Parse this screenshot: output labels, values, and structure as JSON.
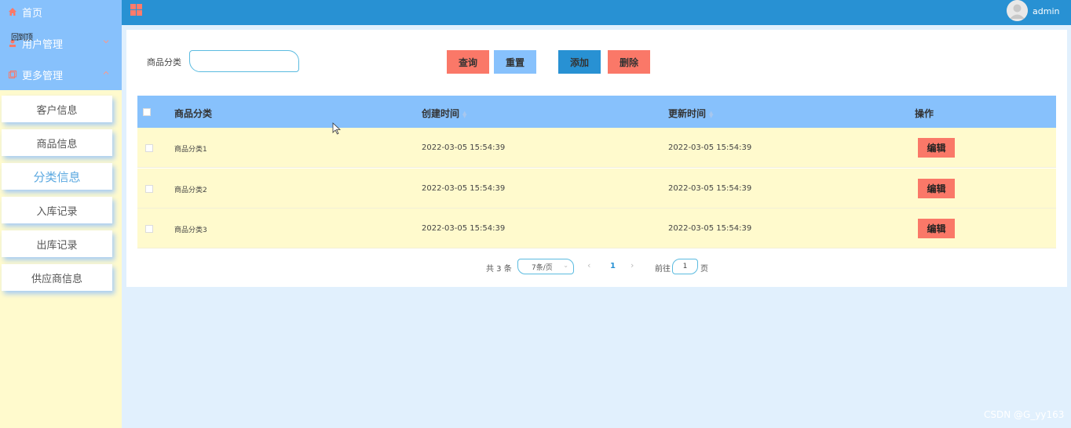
{
  "sidebar": {
    "home_label": "首页",
    "user_mgmt_label": "用户管理",
    "more_mgmt_label": "更多管理",
    "overlay_text": "回到顶",
    "items": [
      {
        "label": "客户信息"
      },
      {
        "label": "商品信息"
      },
      {
        "label": "分类信息"
      },
      {
        "label": "入库记录"
      },
      {
        "label": "出库记录"
      },
      {
        "label": "供应商信息"
      }
    ]
  },
  "header": {
    "user_name": "admin"
  },
  "search": {
    "label": "商品分类",
    "value": "",
    "placeholder": ""
  },
  "toolbar": {
    "query_label": "查询",
    "reset_label": "重置",
    "add_label": "添加",
    "delete_label": "删除"
  },
  "table": {
    "columns": [
      "商品分类",
      "创建时间",
      "更新时间",
      "操作"
    ],
    "rows": [
      {
        "name": "商品分类1",
        "created": "2022-03-05 15:54:39",
        "updated": "2022-03-05 15:54:39",
        "action": "编辑"
      },
      {
        "name": "商品分类2",
        "created": "2022-03-05 15:54:39",
        "updated": "2022-03-05 15:54:39",
        "action": "编辑"
      },
      {
        "name": "商品分类3",
        "created": "2022-03-05 15:54:39",
        "updated": "2022-03-05 15:54:39",
        "action": "编辑"
      }
    ]
  },
  "pagination": {
    "total_text": "共 3 条",
    "page_size": "7条/页",
    "current_page": "1",
    "goto_label": "前往",
    "goto_value": "1",
    "page_suffix": "页"
  },
  "watermark": "CSDN @G_yy163",
  "colors": {
    "topbar": "#2891d3",
    "sidebar_top": "#87c1fc",
    "sidebar_bg": "#fffacd",
    "accent_red": "#fa7868",
    "row_bg": "#fffacd"
  }
}
